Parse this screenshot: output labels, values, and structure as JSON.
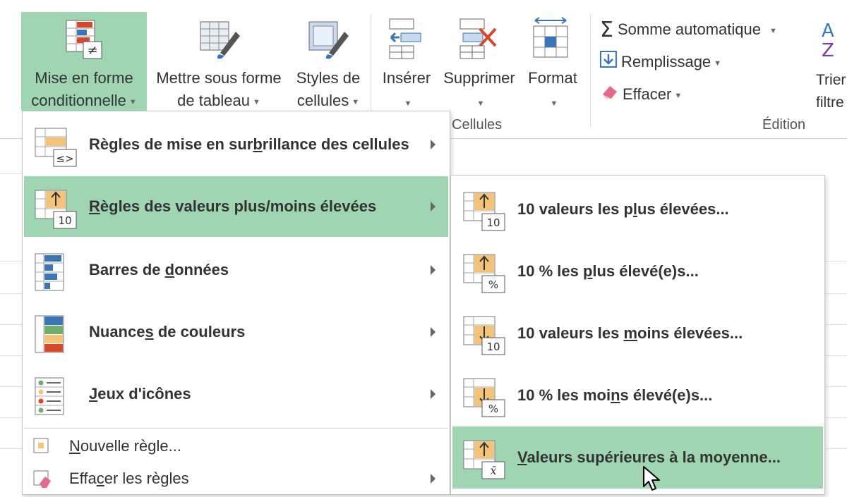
{
  "ribbon": {
    "conditional_formatting": {
      "line1": "Mise en forme",
      "line2": "conditionnelle"
    },
    "format_as_table": {
      "line1": "Mettre sous forme",
      "line2": "de tableau"
    },
    "cell_styles": {
      "line1": "Styles de",
      "line2": "cellules"
    },
    "insert": {
      "label": "Insérer"
    },
    "delete": {
      "label": "Supprimer"
    },
    "format": {
      "label": "Format"
    },
    "group_cells_label": "Cellules",
    "group_editing_label": "Édition",
    "autosum": {
      "label": "Somme automatique"
    },
    "fill": {
      "label": "Remplissage"
    },
    "clear": {
      "label": "Effacer"
    },
    "sort_filter": {
      "line1": "Trier",
      "line2": "filtre"
    }
  },
  "menu": {
    "items": [
      {
        "pre": "Règles de mise en sur",
        "ul": "b",
        "post": "rillance des cellules"
      },
      {
        "pre": "",
        "ul": "R",
        "post": "ègles des valeurs plus/moins élevées"
      },
      {
        "pre": "Barres de ",
        "ul": "d",
        "post": "onnées"
      },
      {
        "pre": "Nuance",
        "ul": "s",
        "post": " de couleurs"
      },
      {
        "pre": "",
        "ul": "J",
        "post": "eux d'icônes"
      }
    ],
    "new_rule": {
      "pre": "",
      "ul": "N",
      "post": "ouvelle règle..."
    },
    "clear_rules": {
      "pre": "Effa",
      "ul": "c",
      "post": "er les règles"
    },
    "icon_badges": {
      "highlight": "≤>",
      "topbottom": "10"
    }
  },
  "submenu": {
    "items": [
      {
        "pre": "10 valeurs les p",
        "ul": "l",
        "post": "us élevées...",
        "badge": "10"
      },
      {
        "pre": "10 % les ",
        "ul": "p",
        "post": "lus élevé(e)s...",
        "badge": "%"
      },
      {
        "pre": "10 valeurs les ",
        "ul": "m",
        "post": "oins élevées...",
        "badge": "10"
      },
      {
        "pre": "10 % les moi",
        "ul": "n",
        "post": "s élevé(e)s...",
        "badge": "%"
      },
      {
        "pre": "",
        "ul": "V",
        "post": "aleurs supérieures à la moyenne...",
        "badge": "x̄"
      }
    ]
  },
  "colors": {
    "accent_green": "#9fd5b2",
    "orange": "#f3c37a",
    "blue": "#3a75b8",
    "red": "#d9472b"
  }
}
